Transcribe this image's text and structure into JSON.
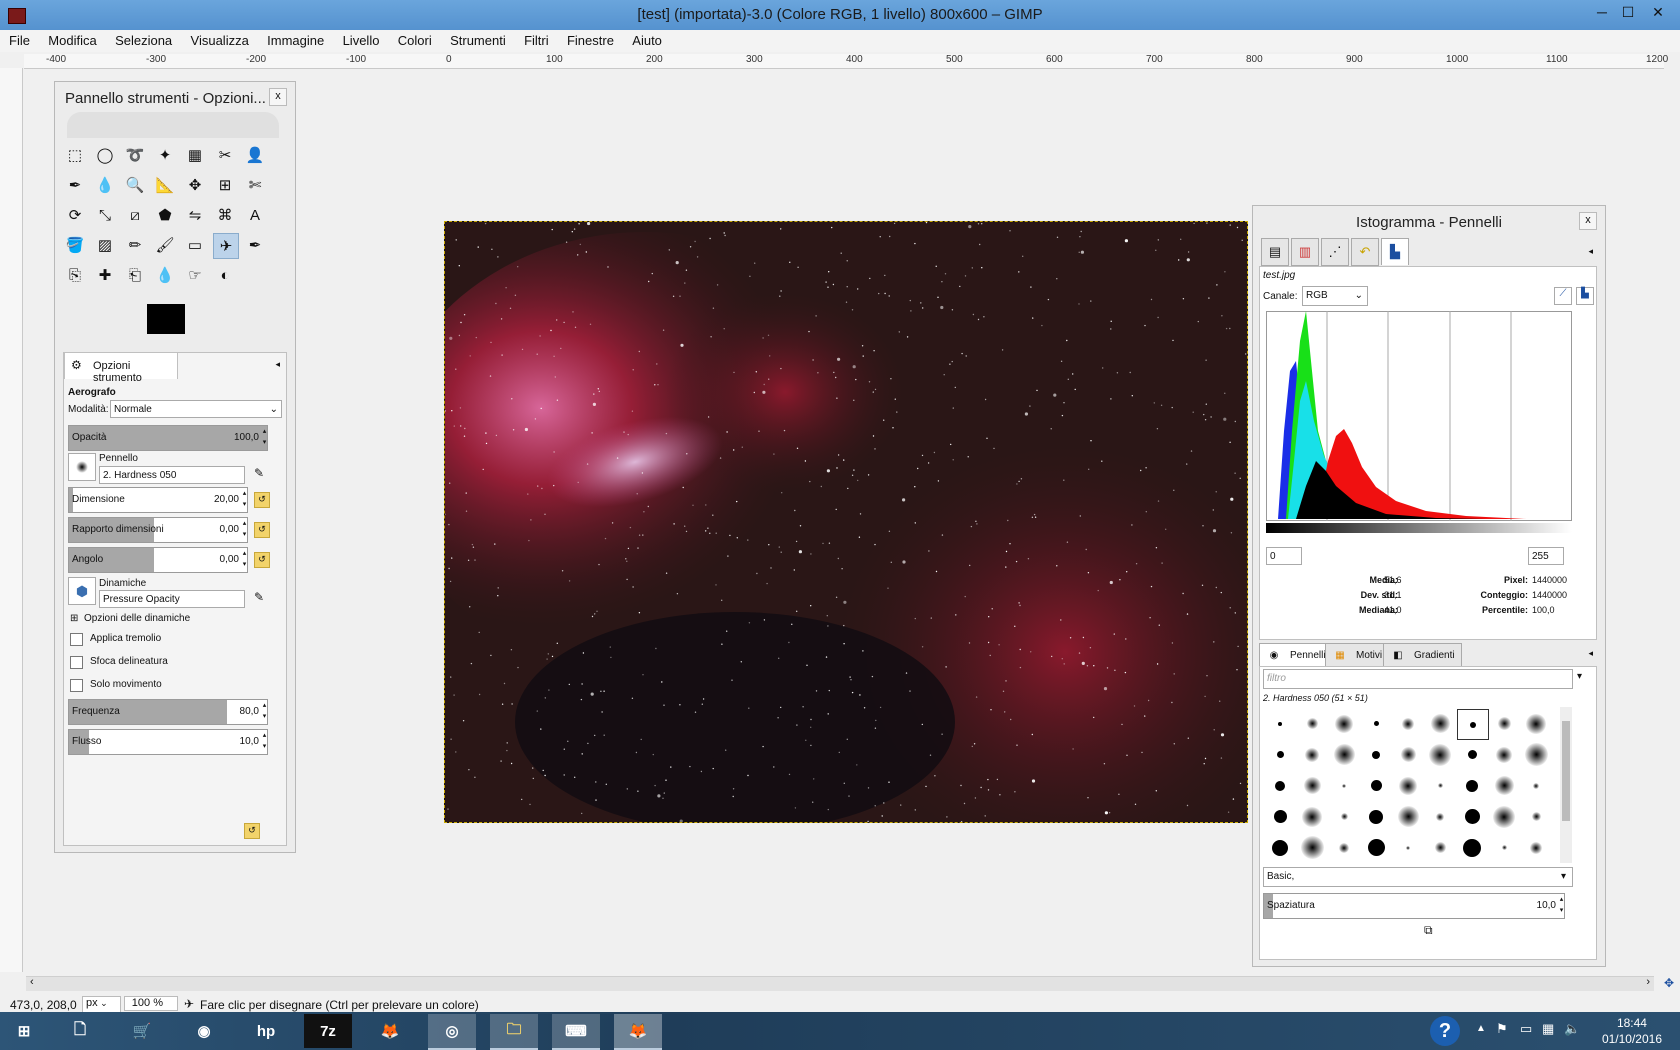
{
  "window": {
    "title": "[test] (importata)-3.0 (Colore RGB, 1 livello) 800x600 – GIMP",
    "min": "─",
    "max": "☐",
    "close": "✕"
  },
  "menu": [
    "File",
    "Modifica",
    "Seleziona",
    "Visualizza",
    "Immagine",
    "Livello",
    "Colori",
    "Strumenti",
    "Filtri",
    "Finestre",
    "Aiuto"
  ],
  "ruler": {
    "labels": [
      "-400",
      "-300",
      "-200",
      "-100",
      "0",
      "100",
      "200",
      "300",
      "400",
      "500",
      "600",
      "700",
      "800",
      "900",
      "1000",
      "1100",
      "1200"
    ]
  },
  "toolbox": {
    "title": "Pannello strumenti - Opzioni...",
    "close": "x",
    "tools": [
      "rect-select",
      "ellipse-select",
      "free-select",
      "fuzzy-select",
      "select-by-color",
      "scissors",
      "foreground-select",
      "paths",
      "color-picker",
      "zoom",
      "measure",
      "move",
      "align",
      "crop",
      "rotate",
      "scale",
      "shear",
      "perspective",
      "flip",
      "cage",
      "text",
      "bucket-fill",
      "blend",
      "pencil",
      "paintbrush",
      "eraser",
      "airbrush",
      "ink",
      "clone",
      "heal",
      "perspective-clone",
      "blur",
      "smudge",
      "dodge-burn"
    ],
    "tool_glyphs": [
      "⬚",
      "◯",
      "➰",
      "✦",
      "▦",
      "✂",
      "👤",
      "✒",
      "💧",
      "🔍",
      "📐",
      "✥",
      "⊞",
      "✄",
      "⟳",
      "⤡",
      "⧄",
      "⬟",
      "⇋",
      "⌘",
      "A",
      "🪣",
      "▨",
      "✏",
      "🖌",
      "▭",
      "✈",
      "✒",
      "⎘",
      "✚",
      "⎗",
      "💧",
      "☞",
      "◐"
    ],
    "selected_tool": "airbrush"
  },
  "options": {
    "tab_label": "Opzioni strumento",
    "tool_name": "Aerografo",
    "mode_label": "Modalità:",
    "mode_value": "Normale",
    "opacity_label": "Opacità",
    "opacity_value": "100,0",
    "opacity_pct": 100,
    "brush_label": "Pennello",
    "brush_value": "2. Hardness 050",
    "size_label": "Dimensione",
    "size_value": "20,00",
    "aspect_label": "Rapporto dimensioni",
    "aspect_value": "0,00",
    "angle_label": "Angolo",
    "angle_value": "0,00",
    "dynamics_label": "Dinamiche",
    "dynamics_value": "Pressure Opacity",
    "dyn_opts_label": "Opzioni delle dinamiche",
    "jitter_label": "Applica tremolio",
    "smooth_label": "Sfoca delineatura",
    "motion_label": "Solo movimento",
    "rate_label": "Frequenza",
    "rate_value": "80,0",
    "rate_pct": 80,
    "flow_label": "Flusso",
    "flow_value": "10,0",
    "flow_pct": 10
  },
  "histogram": {
    "title": "Istogramma - Pennelli",
    "close": "x",
    "file": "test.jpg",
    "channel_label": "Canale:",
    "channel_value": "RGB",
    "range_min": "0",
    "range_max": "255",
    "media_label": "Media:",
    "media_value": "51,6",
    "devstd_label": "Dev. std:",
    "devstd_value": "31,1",
    "mediana_label": "Mediana:",
    "mediana_value": "41,0",
    "pixel_label": "Pixel:",
    "pixel_value": "1440000",
    "conteggio_label": "Conteggio:",
    "conteggio_value": "1440000",
    "percentile_label": "Percentile:",
    "percentile_value": "100,0"
  },
  "brushes": {
    "tab_brushes": "Pennelli",
    "tab_patterns": "Motivi",
    "tab_gradients": "Gradienti",
    "filter_placeholder": "filtro",
    "selected_brush": "2. Hardness 050 (51 × 51)",
    "tag_value": "Basic,",
    "spacing_label": "Spaziatura",
    "spacing_value": "10,0",
    "spacing_pct": 3
  },
  "status": {
    "coords": "473,0, 208,0",
    "unit": "px",
    "zoom": "100 %",
    "message": "Fare clic per disegnare (Ctrl per prelevare un colore)"
  },
  "taskbar": {
    "items": [
      "⊞",
      "🗋",
      "🛒",
      "◉",
      "hp",
      "7z",
      "🦊",
      "◎",
      "🗀",
      "⌨",
      "🦊"
    ],
    "time": "18:44",
    "date": "01/10/2016",
    "help": "?"
  },
  "colors": {
    "titlebar": "#5592cf",
    "taskbar": "#274a6c",
    "selection": "#bcd3ea"
  }
}
